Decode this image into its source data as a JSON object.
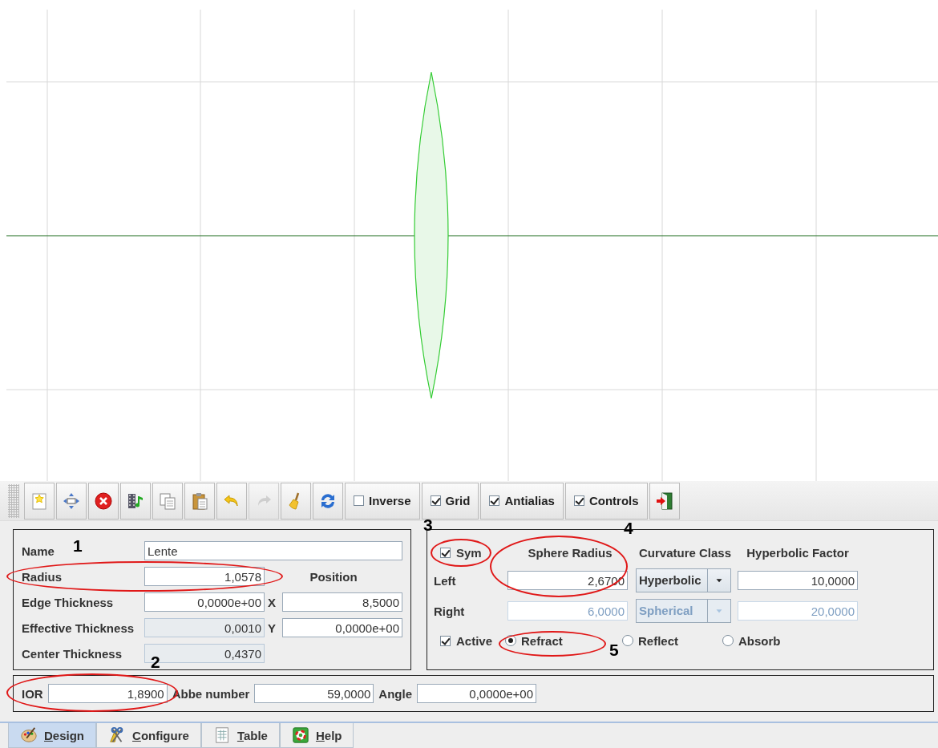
{
  "toolbar": {
    "tools": [
      {
        "kind": "new",
        "disabled": false
      },
      {
        "kind": "move",
        "disabled": false
      },
      {
        "kind": "delete",
        "disabled": false
      },
      {
        "kind": "media",
        "disabled": false
      },
      {
        "kind": "copy",
        "disabled": false
      },
      {
        "kind": "paste",
        "disabled": false
      },
      {
        "kind": "undo",
        "disabled": false
      },
      {
        "kind": "redo",
        "disabled": true
      },
      {
        "kind": "clear",
        "disabled": false
      },
      {
        "kind": "refresh",
        "disabled": false
      }
    ],
    "toggles": [
      {
        "label": "Inverse",
        "checked": false,
        "kind": "inverse"
      },
      {
        "label": "Grid",
        "checked": true,
        "kind": "grid"
      },
      {
        "label": "Antialias",
        "checked": true,
        "kind": "antialias"
      },
      {
        "label": "Controls",
        "checked": true,
        "kind": "controls"
      }
    ],
    "exit": {
      "kind": "exit"
    }
  },
  "properties": [
    {
      "label": "Name",
      "value": "Lente",
      "kind": "wide",
      "editable": true
    },
    {
      "label": "Radius",
      "value": "1,0578",
      "kind": "number",
      "editable": true
    },
    {
      "label": "Edge Thickness",
      "value": "0,0000e+00",
      "kind": "number",
      "editable": true
    },
    {
      "label": "Effective Thickness",
      "value": "0,0010",
      "kind": "number",
      "editable": false
    },
    {
      "label": "Center Thickness",
      "value": "0,4370",
      "kind": "number",
      "editable": false
    }
  ],
  "position": {
    "title": "Position",
    "fields": [
      {
        "label": "X",
        "value": "8,5000"
      },
      {
        "label": "Y",
        "value": "0,0000e+00"
      }
    ]
  },
  "surfaces": {
    "sym": {
      "label": "Sym",
      "checked": true
    },
    "headers": [
      "Sphere Radius",
      "Curvature Class",
      "Hyperbolic Factor"
    ],
    "rows": [
      {
        "label": "Left",
        "radius": "2,6700",
        "curvature": "Hyperbolic",
        "factor": "10,0000",
        "disabled": false
      },
      {
        "label": "Right",
        "radius": "6,0000",
        "curvature": "Spherical",
        "factor": "20,0000",
        "disabled": true
      }
    ],
    "active": {
      "label": "Active",
      "checked": true
    },
    "modes": [
      {
        "label": "Refract",
        "selected": true
      },
      {
        "label": "Reflect",
        "selected": false
      },
      {
        "label": "Absorb",
        "selected": false
      }
    ]
  },
  "material": [
    {
      "label": "IOR",
      "value": "1,8900"
    },
    {
      "label": "Abbe number",
      "value": "59,0000"
    },
    {
      "label": "Angle",
      "value": "0,0000e+00"
    }
  ],
  "annotations": [
    {
      "number": "1"
    },
    {
      "number": "2"
    },
    {
      "number": "3"
    },
    {
      "number": "4"
    },
    {
      "number": "5"
    }
  ],
  "tabs": [
    {
      "label": "Design",
      "selected": true,
      "kind": "palette"
    },
    {
      "label": "Configure",
      "selected": false,
      "kind": "tools"
    },
    {
      "label": "Table",
      "selected": false,
      "kind": "table"
    },
    {
      "label": "Help",
      "selected": false,
      "kind": "help"
    }
  ]
}
